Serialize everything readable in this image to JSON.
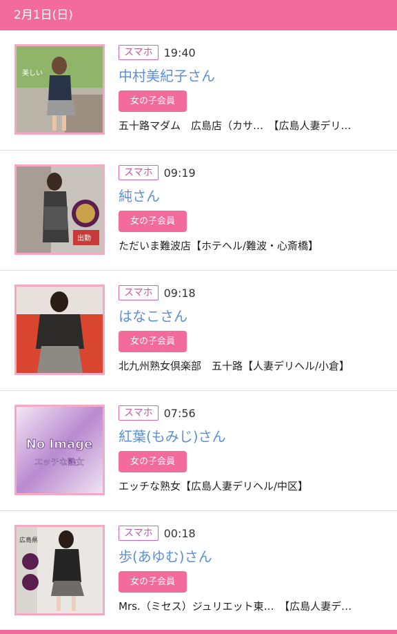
{
  "date_header": "2月1日(日)",
  "entries": [
    {
      "device": "スマホ",
      "time": "19:40",
      "name": "中村美紀子さん",
      "badge": "女の子会員",
      "shop": "五十路マダム　広島店（カサ…　【広島人妻デリ…",
      "thumb_label": "美しい"
    },
    {
      "device": "スマホ",
      "time": "09:19",
      "name": "純さん",
      "badge": "女の子会員",
      "shop": "ただいま難波店【ホテヘル/難波・心斎橋】",
      "thumb_label": "出勤"
    },
    {
      "device": "スマホ",
      "time": "09:18",
      "name": "はなこさん",
      "badge": "女の子会員",
      "shop": "北九州熟女倶楽部　五十路【人妻デリヘル/小倉】",
      "thumb_label": ""
    },
    {
      "device": "スマホ",
      "time": "07:56",
      "name": "紅葉(もみじ)さん",
      "badge": "女の子会員",
      "shop": "エッチな熟女【広島人妻デリヘル/中区】",
      "thumb_label": "No Image",
      "thumb_sub": "エッチな熟女"
    },
    {
      "device": "スマホ",
      "time": "00:18",
      "name": "歩(あゆむ)さん",
      "badge": "女の子会員",
      "shop": "Mrs.（ミセス）ジュリエット東…　【広島人妻デ…",
      "thumb_label": "広島県"
    }
  ],
  "colors": {
    "accent_pink": "#f26b9b",
    "name_blue": "#5b8fd8",
    "tag_border": "#d166a6"
  }
}
